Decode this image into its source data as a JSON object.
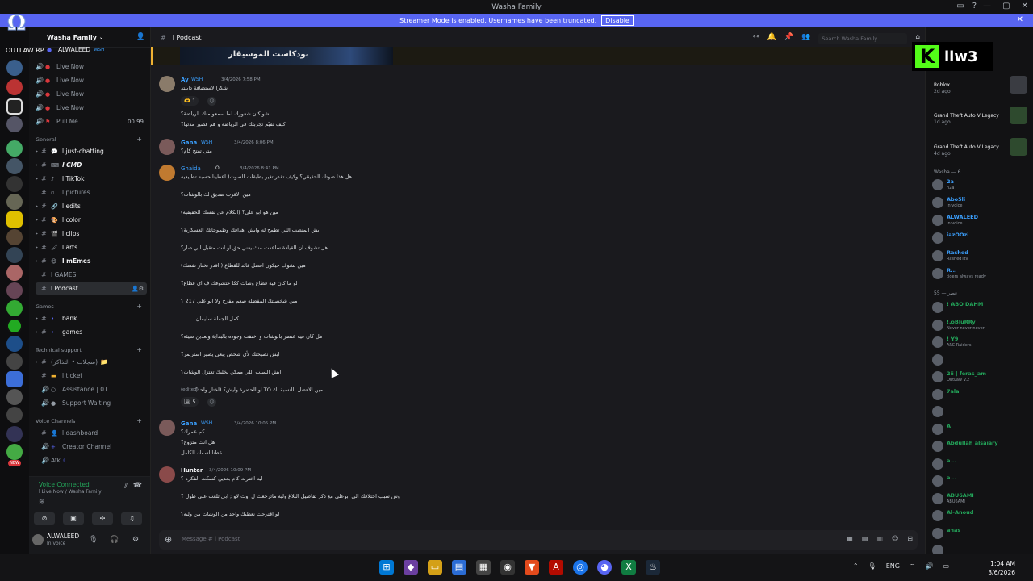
{
  "window": {
    "title": "Washa Family"
  },
  "banner": {
    "text": "Streamer Mode is enabled. Usernames have been truncated.",
    "button": "Disable"
  },
  "watermark": {
    "line1": "OUTLAW RP"
  },
  "server": {
    "name": "Washa Family"
  },
  "channels": {
    "top_user": "ALWALEED",
    "top_tag": "WSH",
    "live": [
      "Live Now",
      "Live Now",
      "Live Now",
      "Live Now"
    ],
    "pull_me": "Pull Me",
    "pull_counts": "00  99",
    "cat_general": "General",
    "general": [
      "l just-chatting",
      "l CMD",
      "l TikTok",
      "l pictures",
      "l edits",
      "l color",
      "l clips",
      "l arts",
      "l mEmes",
      "l GAMES",
      "l Podcast"
    ],
    "cat_games": "Games",
    "games": [
      "bank",
      "games"
    ],
    "cat_support": "Technical support",
    "support": [
      "(سجلات • التذاكر)",
      "l ticket",
      "Assistance | 01",
      "Support Waiting"
    ],
    "cat_voice": "Voice Channels",
    "voice": [
      "l dashboard",
      "Creator Channel",
      "Afk"
    ]
  },
  "voice_panel": {
    "status": "Voice Connected",
    "sub": "l Live Now / Washa Family"
  },
  "user_panel": {
    "name": "ALWALEED",
    "status": "In voice"
  },
  "header": {
    "channel": "l Podcast",
    "search_placeholder": "Search Washa Family"
  },
  "pinned": {
    "text": "بودكاست الموسيقار"
  },
  "messages": [
    {
      "author": "Ay",
      "tag": "WSH",
      "time": "3/4/2026 7:58 PM",
      "lines": [
        "شكرا لاستضافة دايلتد"
      ],
      "react": "1"
    },
    {
      "author": "",
      "tag": "",
      "time": "",
      "lines": [
        "شو كان شعورك لما سمعو منك الرياضة؟",
        "كيف تقيّم تجربتك في الرياضة و هم قصير مدتها؟"
      ]
    },
    {
      "author": "Gana",
      "tag": "WSH",
      "time": "3/4/2026 8:06 PM",
      "lines": [
        "متى تفتح كام؟"
      ]
    },
    {
      "author": "Ghaida",
      "tag": "OL",
      "time": "3/4/2026 8:41 PM",
      "lines": [
        "هل هذا صوتك الحقيقي؟ وكيف تقدر تغير بطبقات الصوت( اعطينا حسبه تطبيعيه",
        "مين الاقرب صديق لك بالوشات؟",
        "مين هو ابو علي؟ (الكلام عن نفسك الحقيقية)",
        "ايش المنصب اللي تطمح له وايش اهدافك وطموحاتك العسكرية؟",
        "هل تشوف ان القيادة ساعدت منك يعني حق او انت متقبل الي صار؟",
        "مين تشوف حيكون افضل قائد للقطاع ( اقدر تختار نفسك)",
        "لو ما كان فيه قطاع وشات ككا حتشوفك ف اي قطاع؟",
        "مين شخصيتك المفضله صعم مفرح ولا ابو علي 217 ؟",
        "كمل الجملة سليمان ........",
        "هل كان فيه عنصر بالوشات و اختفت وجوده بالبداية وبعدين سيئه؟",
        "ايش نصيحتك لأي شخص يبغى يصير استريمر؟",
        "ايش السبب اللي ممكن يخليك تعتزل الوشات؟",
        "مين الافضل بالنسبة لك TO او الحضرة وايش؟ (اختار واحد)"
      ],
      "edited": "(edited)",
      "react": "5"
    },
    {
      "author": "Gana",
      "tag": "WSH",
      "time": "3/4/2026 10:05 PM",
      "lines": [
        "كم عمرك؟",
        "هل انت متزوج؟",
        "عطنا اسمك الكامل"
      ]
    },
    {
      "author": "Hunter",
      "tag": "",
      "time": "3/4/2026 10:09 PM",
      "lines": [
        "ليه اخترت كام بعدين كسكت الفكره ؟",
        "وش سبب اختلافك الي ابوعلي مع ذكر تفاصيل البلاغ وليه ماترجعت ل اوث لاو ; ابي تلعب علي طول ؟",
        "لو اقترحت نعطيك واحد من الوشات من وليه؟"
      ]
    }
  ],
  "composer": {
    "placeholder": "Message # l Podcast"
  },
  "kick": {
    "logo": "K",
    "name": "llw3"
  },
  "members": {
    "activities": [
      {
        "title": "Roblox",
        "sub": "2d ago"
      },
      {
        "title": "Grand Theft Auto V Legacy",
        "sub": "1d ago"
      },
      {
        "title": "Grand Theft Auto V Legacy",
        "sub": "4d ago"
      }
    ],
    "group1": "Washa — 6",
    "list1": [
      {
        "name": "2a",
        "sub": "n2a",
        "color": "#3ba0ff"
      },
      {
        "name": "Abo5li",
        "sub": "In voice",
        "color": "#3ba0ff"
      },
      {
        "name": "ALWALEED",
        "sub": "In voice",
        "color": "#3ba0ff"
      },
      {
        "name": "iazOOzi",
        "sub": "",
        "color": "#3ba0ff"
      },
      {
        "name": "Rashed",
        "sub": "RashedTtv",
        "color": "#3ba0ff"
      },
      {
        "name": "R...",
        "sub": "tigers always ready",
        "color": "#3ba0ff"
      }
    ],
    "group2": "عصر — 55",
    "list2": [
      {
        "name": "! ABO DAHM",
        "sub": "",
        "color": "#23a55a"
      },
      {
        "name": "!.oBluRRy",
        "sub": "Never never never",
        "color": "#23a55a"
      },
      {
        "name": "! Y9",
        "sub": "ARC Raiders",
        "color": "#23a55a"
      },
      {
        "name": "",
        "sub": "",
        "color": "#5865f2"
      },
      {
        "name": "25 | feras_am",
        "sub": "OutLaw V.2",
        "color": "#23a55a"
      },
      {
        "name": "7ala",
        "sub": "",
        "color": "#23a55a"
      },
      {
        "name": "",
        "sub": "",
        "color": "#5865f2"
      },
      {
        "name": "A",
        "sub": "",
        "color": "#23a55a"
      },
      {
        "name": "Abdullah alsaiary",
        "sub": "",
        "color": "#23a55a"
      },
      {
        "name": "a...",
        "sub": "",
        "color": "#23a55a"
      },
      {
        "name": "a...",
        "sub": "",
        "color": "#23a55a"
      },
      {
        "name": "ABU6AMI",
        "sub": "ABU6AMI",
        "color": "#23a55a"
      },
      {
        "name": "Al-Anoud",
        "sub": "",
        "color": "#23a55a"
      },
      {
        "name": "anas",
        "sub": "",
        "color": "#23a55a"
      },
      {
        "name": "",
        "sub": "",
        "color": "#23a55a"
      }
    ]
  },
  "taskbar": {
    "lang": "ENG",
    "time": "1:04 AM",
    "date": "3/6/2026"
  }
}
